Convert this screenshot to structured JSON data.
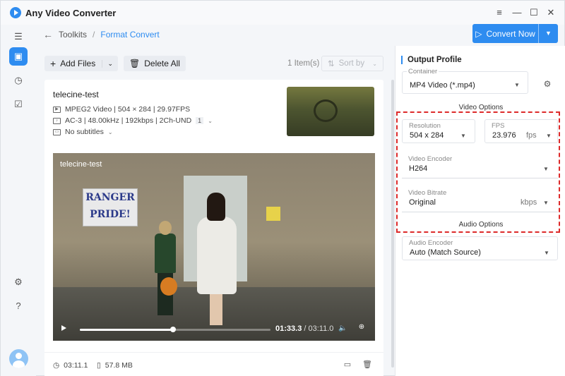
{
  "app": {
    "title": "Any Video Converter"
  },
  "window_controls": {
    "menu": "≡",
    "minimize": "—",
    "maximize": "☐",
    "close": "✕"
  },
  "breadcrumb": {
    "parent": "Toolkits",
    "separator": "/",
    "current": "Format Convert"
  },
  "convert_button": {
    "label": "Convert Now"
  },
  "toolbar": {
    "add_files_label": "Add Files",
    "delete_all_label": "Delete All",
    "item_count": "1 Item(s)",
    "sort_label": "Sort by"
  },
  "file": {
    "name": "telecine-test",
    "video_info": "MPEG2 Video | 504 × 284 | 29.97FPS",
    "audio_info": "AC-3 | 48.00kHz | 192kbps | 2Ch-UND",
    "audio_track_badge": "1",
    "subtitles": "No subtitles",
    "duration": "03:11.1",
    "size": "57.8 MB"
  },
  "player": {
    "title": "telecine-test",
    "current_time": "01:33.3",
    "total_time": "03:11.0",
    "progress_fraction": 0.488,
    "sign_text": "RANGER PRIDE!"
  },
  "output_profile": {
    "title": "Output Profile",
    "container_label": "Container",
    "container_value": "MP4 Video (*.mp4)",
    "video_options_label": "Video Options",
    "resolution_label": "Resolution",
    "resolution_value": "504 x 284",
    "fps_label": "FPS",
    "fps_value": "23.976",
    "fps_unit": "fps",
    "video_encoder_label": "Video Encoder",
    "video_encoder_value": "H264",
    "video_bitrate_label": "Video Bitrate",
    "video_bitrate_value": "Original",
    "video_bitrate_unit": "kbps",
    "audio_options_label": "Audio Options",
    "audio_encoder_label": "Audio Encoder",
    "audio_encoder_value": "Auto (Match Source)"
  },
  "colors": {
    "accent": "#2e8cf0",
    "highlight_border": "#dd2a2a"
  }
}
